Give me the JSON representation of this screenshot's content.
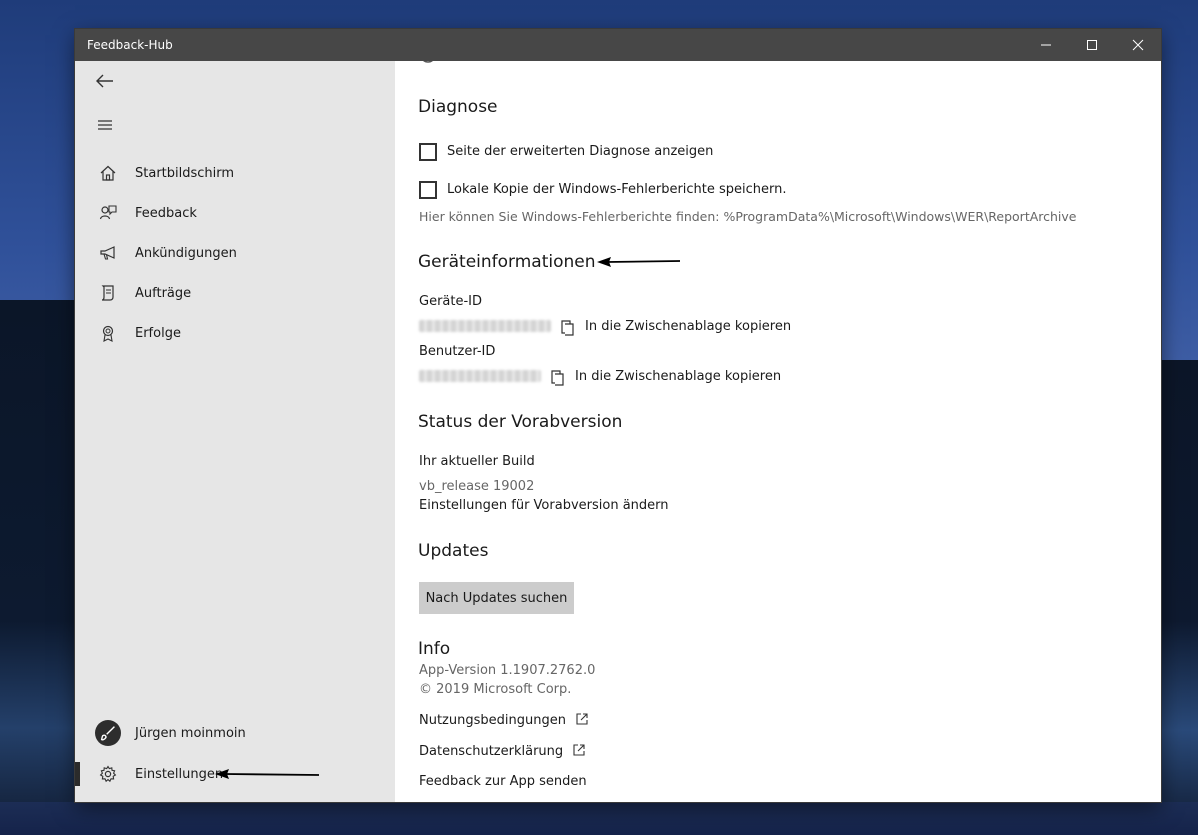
{
  "window": {
    "title": "Feedback-Hub"
  },
  "sidebar": {
    "items": [
      {
        "label": "Startbildschirm",
        "icon": "home-icon"
      },
      {
        "label": "Feedback",
        "icon": "feedback-icon"
      },
      {
        "label": "Ankündigungen",
        "icon": "megaphone-icon"
      },
      {
        "label": "Aufträge",
        "icon": "quest-icon"
      },
      {
        "label": "Erfolge",
        "icon": "medal-icon"
      }
    ],
    "user": "Jürgen moinmoin",
    "settings": "Einstellungen"
  },
  "content": {
    "diagnose": {
      "heading": "Diagnose",
      "checkbox1": "Seite der erweiterten Diagnose anzeigen",
      "checkbox2": "Lokale Kopie der Windows-Fehlerberichte speichern.",
      "note": "Hier können Sie Windows-Fehlerberichte finden: %ProgramData%\\Microsoft\\Windows\\WER\\ReportArchive"
    },
    "device": {
      "heading": "Geräteinformationen",
      "device_id_label": "Geräte-ID",
      "user_id_label": "Benutzer-ID",
      "copy_label": "In die Zwischenablage kopieren"
    },
    "preview": {
      "heading": "Status der Vorabversion",
      "build_label": "Ihr aktueller Build",
      "build_value": "vb_release 19002",
      "change_link": "Einstellungen für Vorabversion ändern"
    },
    "updates": {
      "heading": "Updates",
      "button": "Nach Updates suchen"
    },
    "info": {
      "heading": "Info",
      "version": "App-Version 1.1907.2762.0",
      "copyright": "© 2019 Microsoft Corp.",
      "terms": "Nutzungsbedingungen",
      "privacy": "Datenschutzerklärung",
      "feedback": "Feedback zur App senden"
    }
  },
  "colors": {
    "titlebar": "#474747",
    "sidebar": "#e6e6e6",
    "button": "#cccccc",
    "wallpaper": "#30519a"
  }
}
